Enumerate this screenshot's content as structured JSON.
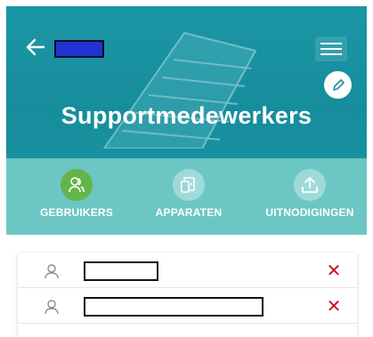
{
  "header": {
    "title": "Supportmedewerkers",
    "back_icon": "arrow-left-icon",
    "menu_icon": "hamburger-menu-icon",
    "edit_icon": "pencil-icon",
    "colors": {
      "primary": "#168d9c",
      "tabbar": "#6cc7c4",
      "active_tab": "#63b54a"
    }
  },
  "tabs": [
    {
      "label": "GEBRUIKERS",
      "icon": "users-icon",
      "active": true
    },
    {
      "label": "APPARATEN",
      "icon": "devices-icon",
      "active": false
    },
    {
      "label": "UITNODIGINGEN",
      "icon": "upload-icon",
      "active": false
    }
  ],
  "users": [
    {
      "icon": "user-icon",
      "delete_label": "✕",
      "delete_color": "#c8102e"
    },
    {
      "icon": "user-icon",
      "delete_label": "✕",
      "delete_color": "#c8102e"
    }
  ]
}
